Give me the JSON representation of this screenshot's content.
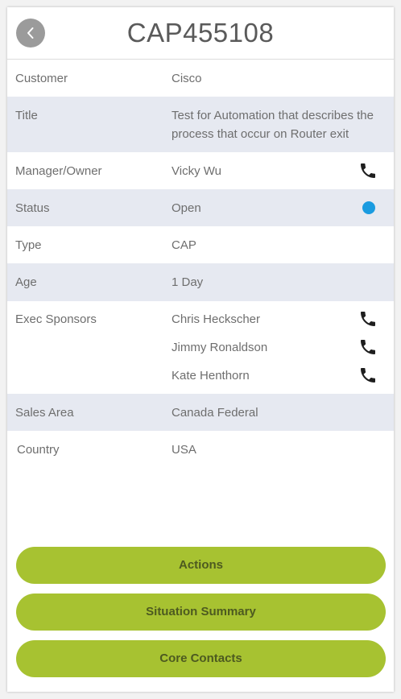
{
  "header": {
    "title": "CAP455108"
  },
  "fields": {
    "customer": {
      "label": "Customer",
      "value": "Cisco"
    },
    "title": {
      "label": "Title",
      "value_line1": "Test for Automation that describes the",
      "value_line2": "process that occur on Router exit"
    },
    "manager": {
      "label": "Manager/Owner",
      "value": "Vicky Wu"
    },
    "status": {
      "label": "Status",
      "value": "Open",
      "color": "#1a9be0"
    },
    "type": {
      "label": "Type",
      "value": "CAP"
    },
    "age": {
      "label": "Age",
      "value": "1 Day"
    },
    "exec_sponsors": {
      "label": "Exec Sponsors",
      "names": [
        "Chris Heckscher",
        "Jimmy Ronaldson",
        "Kate Henthorn"
      ]
    },
    "sales_area": {
      "label": "Sales Area",
      "value": "Canada Federal"
    },
    "country": {
      "label": "Country",
      "value": "USA"
    }
  },
  "actions": {
    "actions_label": "Actions",
    "situation_summary_label": "Situation Summary",
    "core_contacts_label": "Core Contacts"
  },
  "icons": {
    "back": "chevron-left-icon",
    "phone": "phone-icon",
    "status": "status-dot-icon"
  },
  "colors": {
    "accent_green": "#a7c231",
    "row_shade": "#e6e9f1",
    "status_blue": "#1a9be0",
    "back_button": "#9b9b9b"
  }
}
